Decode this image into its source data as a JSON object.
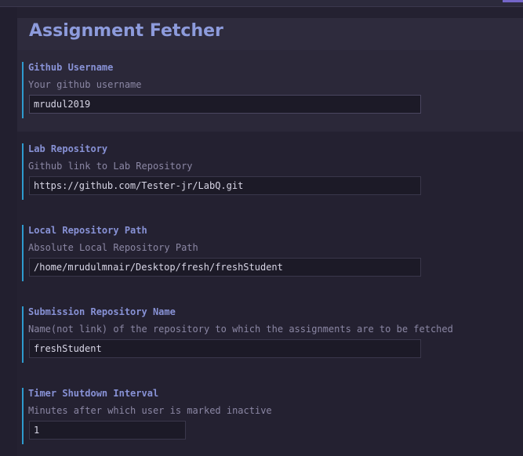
{
  "page": {
    "title": "Assignment Fetcher"
  },
  "settings": [
    {
      "title": "Github Username",
      "description": "Your github username",
      "value": "mrudul2019"
    },
    {
      "title": "Lab Repository",
      "description": "Github link to Lab Repository",
      "value": "https://github.com/Tester-jr/LabQ.git"
    },
    {
      "title": "Local Repository Path",
      "description": "Absolute Local Repository Path",
      "value": "/home/mrudulmnair/Desktop/fresh/freshStudent"
    },
    {
      "title": "Submission Repository Name",
      "description": "Name(not link) of the repository to which the assignments are to be fetched",
      "value": "freshStudent"
    },
    {
      "title": "Timer Shutdown Interval",
      "description": "Minutes after which user is marked inactive",
      "value": "1"
    }
  ],
  "colors": {
    "background": "#242131",
    "header_band": "#2e2b3d",
    "title_text": "#8d9bdc",
    "setting_title": "#8892d6",
    "description_text": "#8b87a4",
    "focus_indicator": "#2e9bcf",
    "input_background": "#1c1a27",
    "accent": "#7466c8"
  }
}
